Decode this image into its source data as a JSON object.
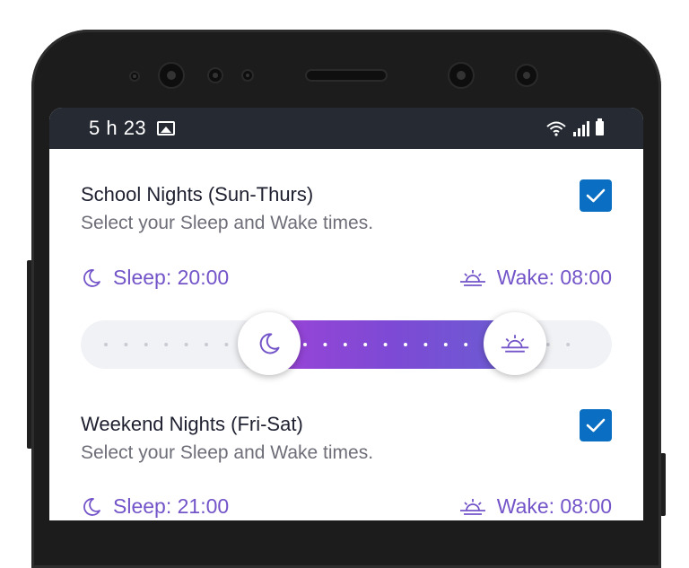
{
  "status_bar": {
    "time": "5 h 23",
    "icons": [
      "gallery-icon",
      "wifi-icon",
      "signal-icon",
      "battery-icon"
    ]
  },
  "school_nights": {
    "title": "School Nights (Sun-Thurs)",
    "subtitle": "Select your Sleep and Wake times.",
    "enabled": true,
    "sleep_label": "Sleep: 20:00",
    "wake_label": "Wake: 08:00"
  },
  "weekend_nights": {
    "title": "Weekend Nights (Fri-Sat)",
    "subtitle": "Select your Sleep and Wake times.",
    "enabled": true,
    "sleep_label": "Sleep: 21:00",
    "wake_label": "Wake: 08:00"
  },
  "colors": {
    "accent": "#7354c9",
    "checkbox": "#0a6fc2",
    "status_bar": "#252a33",
    "range_start": "#9a43d6",
    "range_end": "#6b5cd2"
  }
}
